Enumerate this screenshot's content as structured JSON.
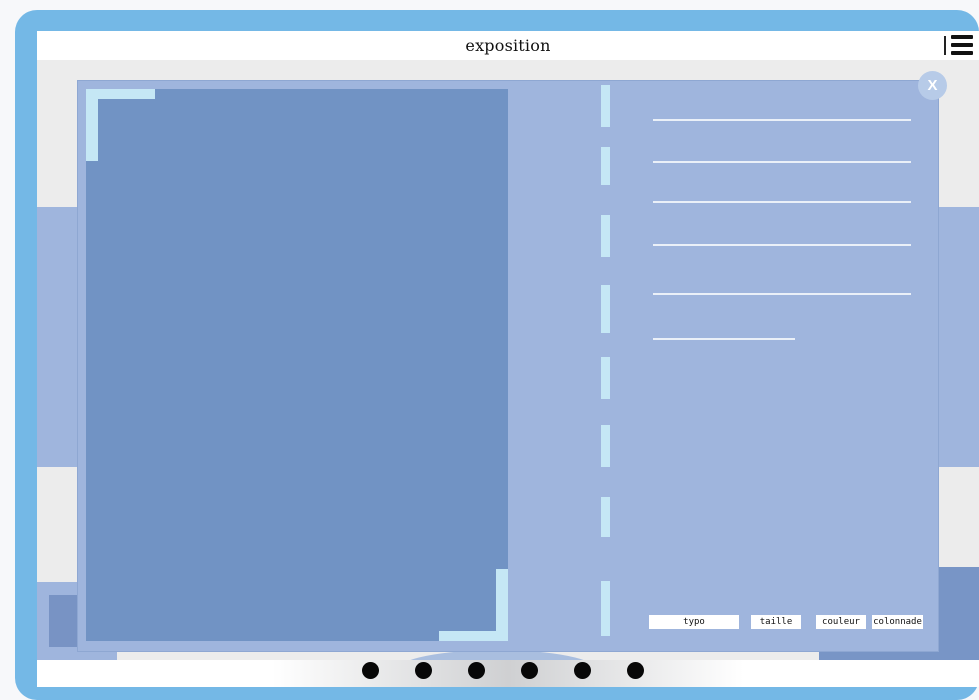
{
  "header": {
    "title": "exposition",
    "menu_icon": "hamburger-icon"
  },
  "overlay": {
    "close_label": "X",
    "text_lines_count": 6,
    "tools": [
      "typo",
      "taille",
      "couleur",
      "colonnade"
    ]
  },
  "pagination": {
    "dot_count": 6
  },
  "colors": {
    "frame": "#74b8e6",
    "panel": "#9fb5dd",
    "image_placeholder": "#7193c4",
    "accent_light": "#c5e7f5"
  }
}
